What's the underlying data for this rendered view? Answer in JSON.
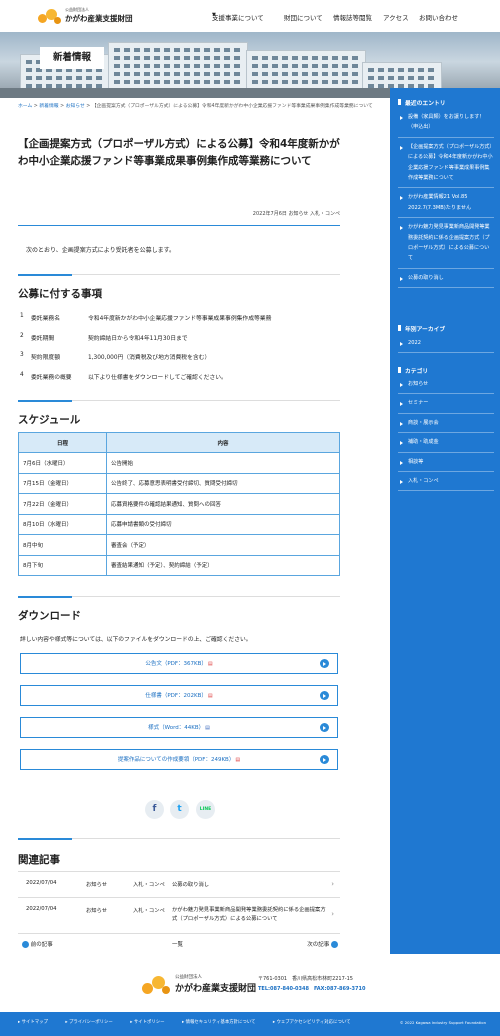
{
  "header": {
    "org_sub": "公益財団法人",
    "org_name": "かがわ産業支援財団",
    "nav": [
      "支援事業について",
      "財団について",
      "情報誌等閲覧",
      "アクセス",
      "お問い合わせ"
    ],
    "nav_caret": "▼"
  },
  "hero": {
    "title": "新着情報"
  },
  "breadcrumb": {
    "items": [
      "ホーム",
      "新着情報",
      "お知らせ"
    ],
    "sep": ">",
    "current": "【企画提案方式（プロポーザル方式）による公募】令和4年度新かがわ中小企業応援ファンド等事業成果事例集作成等業務について"
  },
  "post": {
    "title": "【企画提案方式（プロポーザル方式）による公募】令和4年度新かがわ中小企業応援ファンド等事業成果事例集作成等業務について",
    "date": "2022年7月6日",
    "categories": [
      "お知らせ",
      "入札・コンペ"
    ],
    "intro": "次のとおり、企画提案方式により受託者を公募します。"
  },
  "requirements": {
    "heading": "公募に付する事項",
    "items": [
      {
        "num": "1",
        "key": "委託業務名",
        "value": "令和4年度新かがわ中小企業応援ファンド等事業成果事例集作成等業務"
      },
      {
        "num": "2",
        "key": "委託期間",
        "value": "契約締結日から令和4年11月30日まで"
      },
      {
        "num": "3",
        "key": "契約限度額",
        "value": "1,300,000円（消費税及び地方消費税を含む）"
      },
      {
        "num": "4",
        "key": "委託業務の概要",
        "value": "以下より仕様書をダウンロードしてご確認ください。"
      }
    ]
  },
  "schedule": {
    "heading": "スケジュール",
    "col_date": "日程",
    "col_content": "内容",
    "rows": [
      {
        "date": "7月6日（水曜日）",
        "content": "公告開始"
      },
      {
        "date": "7月15日（金曜日）",
        "content": "公告終了、応募意思表明書受付締切、質問受付締切"
      },
      {
        "date": "7月22日（金曜日）",
        "content": "応募資格要件の確認結果通知、質問への回答"
      },
      {
        "date": "8月10日（水曜日）",
        "content": "応募申請書類の受付締切"
      },
      {
        "date": "8月中旬",
        "content": "審査会（予定）"
      },
      {
        "date": "8月下旬",
        "content": "審査結果通知（予定）、契約締結（予定）"
      }
    ]
  },
  "download": {
    "heading": "ダウンロード",
    "note": "詳しい内容や様式等については、以下のファイルをダウンロードの上、ご確認ください。",
    "files": [
      {
        "label": "公告文（PDF：367KB）",
        "icon": "pdf-icon"
      },
      {
        "label": "仕様書（PDF：202KB）",
        "icon": "pdf-icon"
      },
      {
        "label": "様式（Word：44KB）",
        "icon": "word-icon"
      },
      {
        "label": "提案作品についての作成要領（PDF：249KB）",
        "icon": "pdf-icon"
      }
    ]
  },
  "share": {
    "facebook": "f",
    "twitter": "t",
    "line": "LINE"
  },
  "related": {
    "heading": "関連記事",
    "rows": [
      {
        "date": "2022/07/04",
        "cat1": "お知らせ",
        "cat2": "入札・コンペ",
        "title": "公募の取り消し"
      },
      {
        "date": "2022/07/04",
        "cat1": "お知らせ",
        "cat2": "入札・コンペ",
        "title": "かがわ魅力発見事業新商品開発等業務委託契約に係る企画提案方式（プロポーザル方式）による公募について"
      }
    ],
    "arrow": "›"
  },
  "pager": {
    "prev": "前の記事",
    "list": "一覧",
    "next": "次の記事"
  },
  "sidebar": {
    "recent_heading": "最近のエントリ",
    "recent": [
      "設備（家具類）をお譲りします！（申込出）",
      "【企画提案方式（プロポーザル方式）による公募】令和4年度新かがわ中小企業応援ファンド等事業成果事例集作成等業務について",
      "かがわ産業情報21 Vol.85 2022.7(7.3MB)たりません",
      "かがわ魅力発見事業新商品開発等業務委託契約に係る企画提案方式（プロポーザル方式）による公募について",
      "公募の取り消し"
    ],
    "archive_heading": "年別アーカイブ",
    "archive": [
      "2022"
    ],
    "category_heading": "カテゴリ",
    "categories": [
      "お知らせ",
      "セミナー",
      "商談・展示会",
      "補助・助成金",
      "相談等",
      "入札・コンペ"
    ]
  },
  "footer": {
    "org_sub": "公益財団法人",
    "org_name": "かがわ産業支援財団",
    "address": "〒761-0301　香川県高松市林町2217-15",
    "tel": "TEL:087-840-0348　FAX:087-869-3710",
    "links": [
      "サイトマップ",
      "プライバシーポリシー",
      "サイトポリシー",
      "情報セキュリティ基本方針について",
      "ウェブアクセシビリティ対応について"
    ],
    "copyright": "© 2022 Kagawa Industry Support Foundation"
  },
  "colors": {
    "accent": "#1f78d1",
    "line": "#2a8ad8",
    "table_head": "#d7eaf8",
    "logo_orange": "#f5a623"
  }
}
